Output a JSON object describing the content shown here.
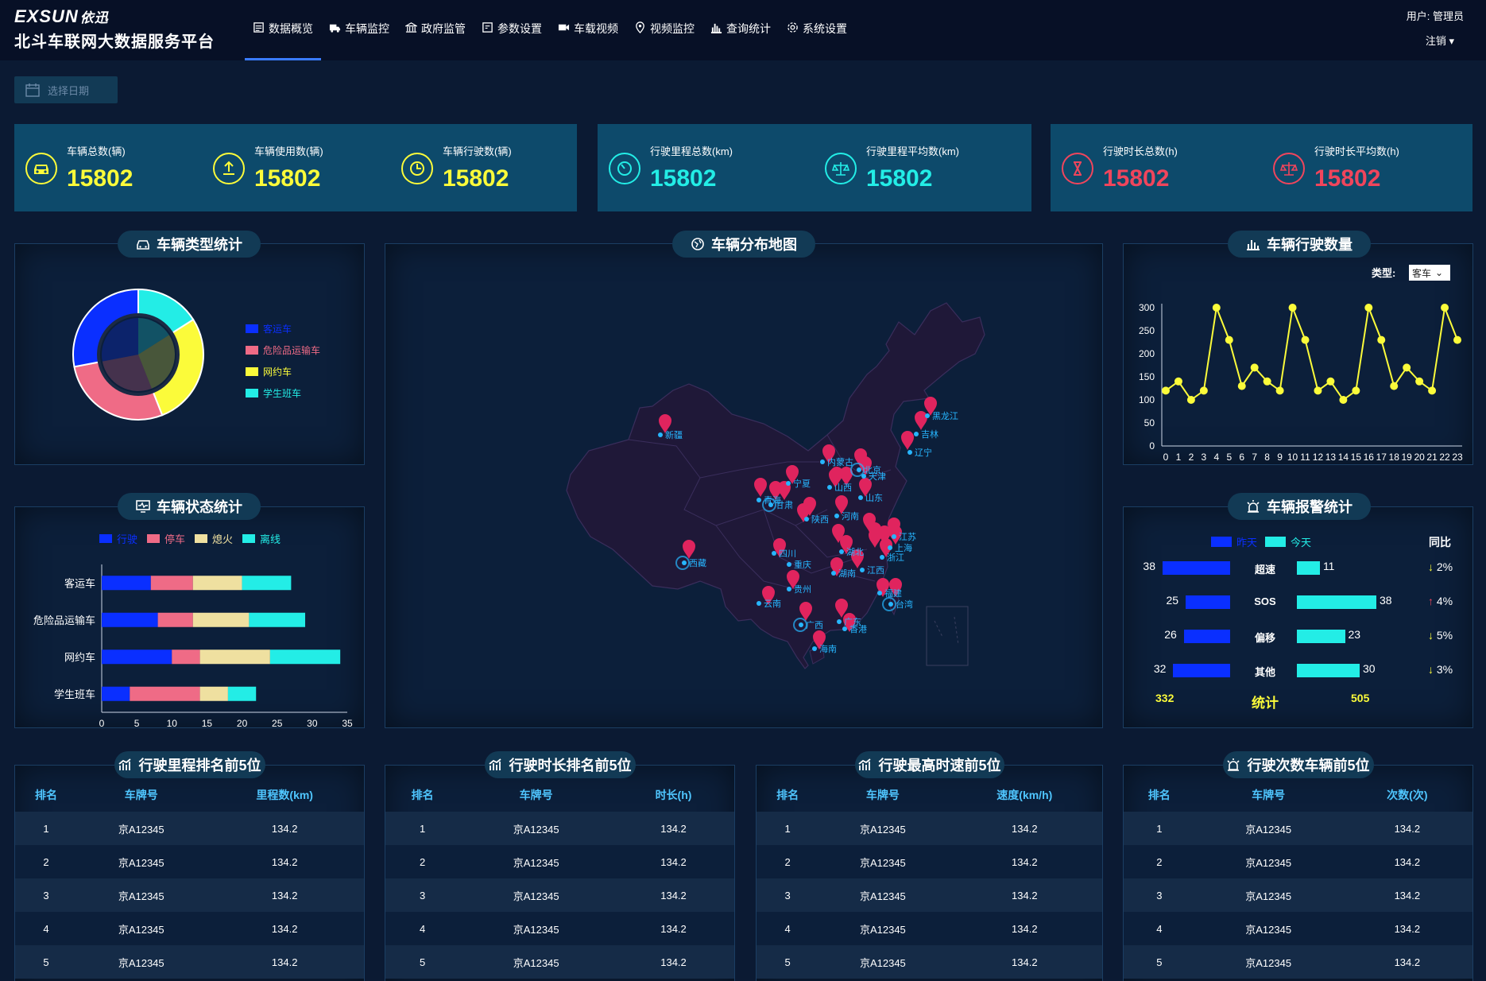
{
  "header": {
    "logo_text": "EXSUN",
    "logo_cn": "依迅",
    "title": "北斗车联网大数据服务平台",
    "nav": [
      {
        "label": "数据概览",
        "icon": "overview-icon",
        "active": true
      },
      {
        "label": "车辆监控",
        "icon": "truck-icon",
        "active": false
      },
      {
        "label": "政府监管",
        "icon": "government-icon",
        "active": false
      },
      {
        "label": "参数设置",
        "icon": "settings-form-icon",
        "active": false
      },
      {
        "label": "车载视频",
        "icon": "video-camera-icon",
        "active": false
      },
      {
        "label": "视频监控",
        "icon": "location-pin-icon",
        "active": false
      },
      {
        "label": "查询统计",
        "icon": "bar-chart-icon",
        "active": false
      },
      {
        "label": "系统设置",
        "icon": "gear-icon",
        "active": false
      }
    ],
    "user": "用户: 管理员",
    "logout": "注销"
  },
  "date_picker": {
    "placeholder": "选择日期"
  },
  "stats": {
    "vehicles_total": {
      "label": "车辆总数(辆)",
      "value": "15802"
    },
    "vehicles_used": {
      "label": "车辆使用数(辆)",
      "value": "15802"
    },
    "vehicles_driving": {
      "label": "车辆行驶数(辆)",
      "value": "15802"
    },
    "mileage_total": {
      "label": "行驶里程总数(km)",
      "value": "15802"
    },
    "mileage_avg": {
      "label": "行驶里程平均数(km)",
      "value": "15802"
    },
    "duration_total": {
      "label": "行驶时长总数(h)",
      "value": "15802"
    },
    "duration_avg": {
      "label": "行驶时长平均数(h)",
      "value": "15802"
    }
  },
  "colors": {
    "blue": "#0a2fff",
    "pink": "#ef6b86",
    "yellow": "#fbfb3a",
    "cyan": "#23ede6",
    "khaki": "#efe0a0",
    "bg": "#0b1a33"
  },
  "vehicle_type": {
    "title": "车辆类型统计",
    "items": [
      {
        "name": "客运车",
        "value": 0.28,
        "color": "#0a2fff"
      },
      {
        "name": "危险品运输车",
        "value": 0.28,
        "color": "#ef6b86"
      },
      {
        "name": "网约车",
        "value": 0.28,
        "color": "#fbfb3a"
      },
      {
        "name": "学生班车",
        "value": 0.16,
        "color": "#23ede6"
      }
    ]
  },
  "map": {
    "title": "车辆分布地图",
    "labels": [
      "新疆",
      "内蒙古",
      "黑龙江",
      "吉林",
      "辽宁",
      "北京",
      "天津",
      "宁夏",
      "山西",
      "山东",
      "青海",
      "甘肃",
      "陕西",
      "河南",
      "江苏",
      "四川",
      "湖北",
      "上海",
      "浙江",
      "重庆",
      "湖南",
      "江西",
      "西藏",
      "贵州",
      "云南",
      "福建",
      "台湾",
      "广西",
      "广东",
      "香港",
      "海南"
    ]
  },
  "driving_count": {
    "title": "车辆行驶数量",
    "type_label": "类型:",
    "type_value": "客车"
  },
  "vehicle_status": {
    "title": "车辆状态统计",
    "legend": [
      "行驶",
      "停车",
      "熄火",
      "离线"
    ]
  },
  "alarm": {
    "title": "车辆报警统计",
    "legend_yesterday": "昨天",
    "legend_today": "今天",
    "yoy_label": "同比",
    "rows": [
      {
        "name": "超速",
        "yesterday": "38",
        "today": "11",
        "yoy": "2%",
        "dir": "down",
        "y": 38,
        "t": 11
      },
      {
        "name": "SOS",
        "yesterday": "25",
        "today": "38",
        "yoy": "4%",
        "dir": "up",
        "y": 25,
        "t": 38
      },
      {
        "name": "偏移",
        "yesterday": "26",
        "today": "23",
        "yoy": "5%",
        "dir": "down",
        "y": 26,
        "t": 23
      },
      {
        "name": "其他",
        "yesterday": "32",
        "today": "30",
        "yoy": "3%",
        "dir": "down",
        "y": 32,
        "t": 30
      }
    ],
    "total_yesterday": "332",
    "total_label": "统计",
    "total_today": "505"
  },
  "rankings": [
    {
      "title": "行驶里程排名前5位",
      "icon": "bar-chart-icon",
      "cols": [
        "排名",
        "车牌号",
        "里程数(km)"
      ],
      "rows": [
        [
          "1",
          "京A12345",
          "134.2"
        ],
        [
          "2",
          "京A12345",
          "134.2"
        ],
        [
          "3",
          "京A12345",
          "134.2"
        ],
        [
          "4",
          "京A12345",
          "134.2"
        ],
        [
          "5",
          "京A12345",
          "134.2"
        ]
      ]
    },
    {
      "title": "行驶时长排名前5位",
      "icon": "bar-chart-icon",
      "cols": [
        "排名",
        "车牌号",
        "时长(h)"
      ],
      "rows": [
        [
          "1",
          "京A12345",
          "134.2"
        ],
        [
          "2",
          "京A12345",
          "134.2"
        ],
        [
          "3",
          "京A12345",
          "134.2"
        ],
        [
          "4",
          "京A12345",
          "134.2"
        ],
        [
          "5",
          "京A12345",
          "134.2"
        ]
      ]
    },
    {
      "title": "行驶最高时速前5位",
      "icon": "bar-chart-icon",
      "cols": [
        "排名",
        "车牌号",
        "速度(km/h)"
      ],
      "rows": [
        [
          "1",
          "京A12345",
          "134.2"
        ],
        [
          "2",
          "京A12345",
          "134.2"
        ],
        [
          "3",
          "京A12345",
          "134.2"
        ],
        [
          "4",
          "京A12345",
          "134.2"
        ],
        [
          "5",
          "京A12345",
          "134.2"
        ]
      ]
    },
    {
      "title": "行驶次数车辆前5位",
      "icon": "alarm-light-icon",
      "cols": [
        "排名",
        "车牌号",
        "次数(次)"
      ],
      "rows": [
        [
          "1",
          "京A12345",
          "134.2"
        ],
        [
          "2",
          "京A12345",
          "134.2"
        ],
        [
          "3",
          "京A12345",
          "134.2"
        ],
        [
          "4",
          "京A12345",
          "134.2"
        ],
        [
          "5",
          "京A12345",
          "134.2"
        ]
      ]
    }
  ],
  "chart_data": [
    {
      "type": "line",
      "title": "车辆行驶数量",
      "x": [
        0,
        1,
        2,
        3,
        4,
        5,
        6,
        7,
        8,
        9,
        10,
        11,
        12,
        13,
        14,
        15,
        16,
        17,
        18,
        19,
        20,
        21,
        22,
        23
      ],
      "series": [
        {
          "values": [
            120,
            140,
            100,
            120,
            300,
            230,
            130,
            170,
            140,
            120,
            300,
            230,
            120,
            140,
            100,
            120,
            300,
            230,
            130,
            170,
            140,
            120,
            300,
            230
          ]
        }
      ],
      "ylim": [
        0,
        300
      ],
      "yticks": [
        0,
        50,
        100,
        150,
        200,
        250,
        300
      ],
      "color": "#fbfb3a",
      "grid": false
    },
    {
      "type": "bar",
      "orientation": "horizontal-stacked",
      "title": "车辆状态统计",
      "categories": [
        "客运车",
        "危险品运输车",
        "网约车",
        "学生班车"
      ],
      "series": [
        {
          "name": "行驶",
          "values": [
            7,
            8,
            10,
            4
          ],
          "color": "#0a2fff"
        },
        {
          "name": "停车",
          "values": [
            6,
            5,
            4,
            10
          ],
          "color": "#ef6b86"
        },
        {
          "name": "熄火",
          "values": [
            7,
            8,
            10,
            4
          ],
          "color": "#efe0a0"
        },
        {
          "name": "离线",
          "values": [
            7,
            8,
            10,
            4
          ],
          "color": "#23ede6"
        }
      ],
      "xlim": [
        0,
        35
      ],
      "xticks": [
        0,
        5,
        10,
        15,
        20,
        25,
        30,
        35
      ],
      "legend": "top"
    }
  ]
}
